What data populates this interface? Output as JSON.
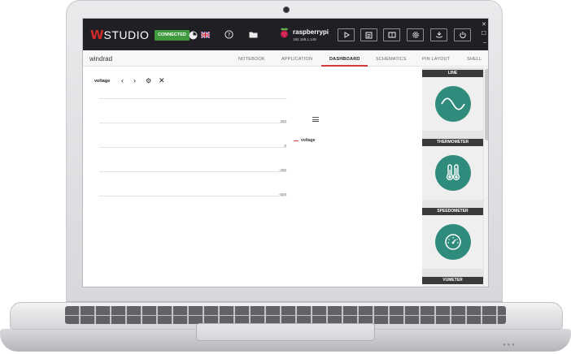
{
  "app": {
    "logo_mark": "W",
    "logo_text": "STUDIO",
    "status_badge": "CONNECTED",
    "language_flag": "flag-uk-icon",
    "device": {
      "name": "raspberrypi",
      "ip": "192.168.1.148"
    }
  },
  "toolbar": {
    "help_icon": "help-icon",
    "folder_icon": "folder-icon",
    "run_icon": "play-icon",
    "console_icon": "console-icon",
    "book_icon": "book-icon",
    "settings_icon": "settings-icon",
    "deploy_icon": "deploy-icon",
    "power_icon": "power-icon"
  },
  "project": {
    "name": "windrad"
  },
  "tabs": [
    {
      "label": "NOTEBOOK"
    },
    {
      "label": "APPLICATION"
    },
    {
      "label": "DASHBOARD",
      "active": true
    },
    {
      "label": "SCHEMATICS"
    },
    {
      "label": "PIN LAYOUT"
    },
    {
      "label": "SHELL"
    }
  ],
  "dashboard": {
    "element_label": "voltage",
    "controls": {
      "prev": "‹",
      "next": "›",
      "settings": "⚙",
      "close": "✕"
    },
    "chart_data": {
      "type": "line",
      "title": "",
      "xlabel": "",
      "ylabel": "",
      "y_ticks": [
        "250",
        "0",
        "-250",
        "-500"
      ],
      "ylim": [
        -500,
        500
      ],
      "series": [
        {
          "name": "voltage",
          "values": []
        }
      ],
      "legend_position": "right",
      "series_color": "#e04a4a"
    }
  },
  "sidebar": {
    "cards": [
      {
        "title": "LINE",
        "icon": "line-wave-icon"
      },
      {
        "title": "THERMOMETER",
        "icon": "thermometer-icon"
      },
      {
        "title": "SPEEDOMETER",
        "icon": "speedometer-icon"
      },
      {
        "title": "VUMETER",
        "icon": "vumeter-icon"
      }
    ]
  },
  "colors": {
    "accent": "#d33d3d",
    "tile": "#2f8c7c",
    "topbar": "#202024",
    "connected": "#3f9a3f"
  }
}
